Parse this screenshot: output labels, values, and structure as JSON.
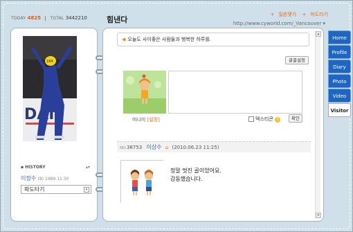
{
  "header": {
    "today_label": "TODAY",
    "today_value": "4825",
    "total_label": "TOTAL",
    "total_value": "3442210",
    "title": "힘낸다",
    "link_1": "일촌맺기",
    "link_2": "파도타기",
    "url": "http://www.cyworld.com/_Vancouver"
  },
  "profile": {
    "history_label": "HISTORY",
    "name": "이정수",
    "meta": "(8) 1989.11.30",
    "select_value": "파도타기"
  },
  "main": {
    "motto": "오늘도 사이좋은 사람들과 행복한 하루를.",
    "settings_button": "글꼴설정",
    "minimi_label": "미니미",
    "minimi_set": "[설정]",
    "emoticon_label": "텍스티콘",
    "confirm_button": "확인",
    "post": {
      "no_label": "NO.",
      "number": "38753",
      "author": "이상수",
      "datetime": "(2010.06.23 11:25)",
      "line1": "정말 멋진 골이었어요.",
      "line2": "감동했습니다."
    }
  },
  "tabs": [
    {
      "label": "Home"
    },
    {
      "label": "Profile"
    },
    {
      "label": "Diary"
    },
    {
      "label": "Photo"
    },
    {
      "label": "Video"
    },
    {
      "label": "Visitor"
    }
  ],
  "colors": {
    "accent_orange": "#e86a12",
    "tab_blue": "#1e66c2",
    "link_blue": "#3c6bb0"
  }
}
